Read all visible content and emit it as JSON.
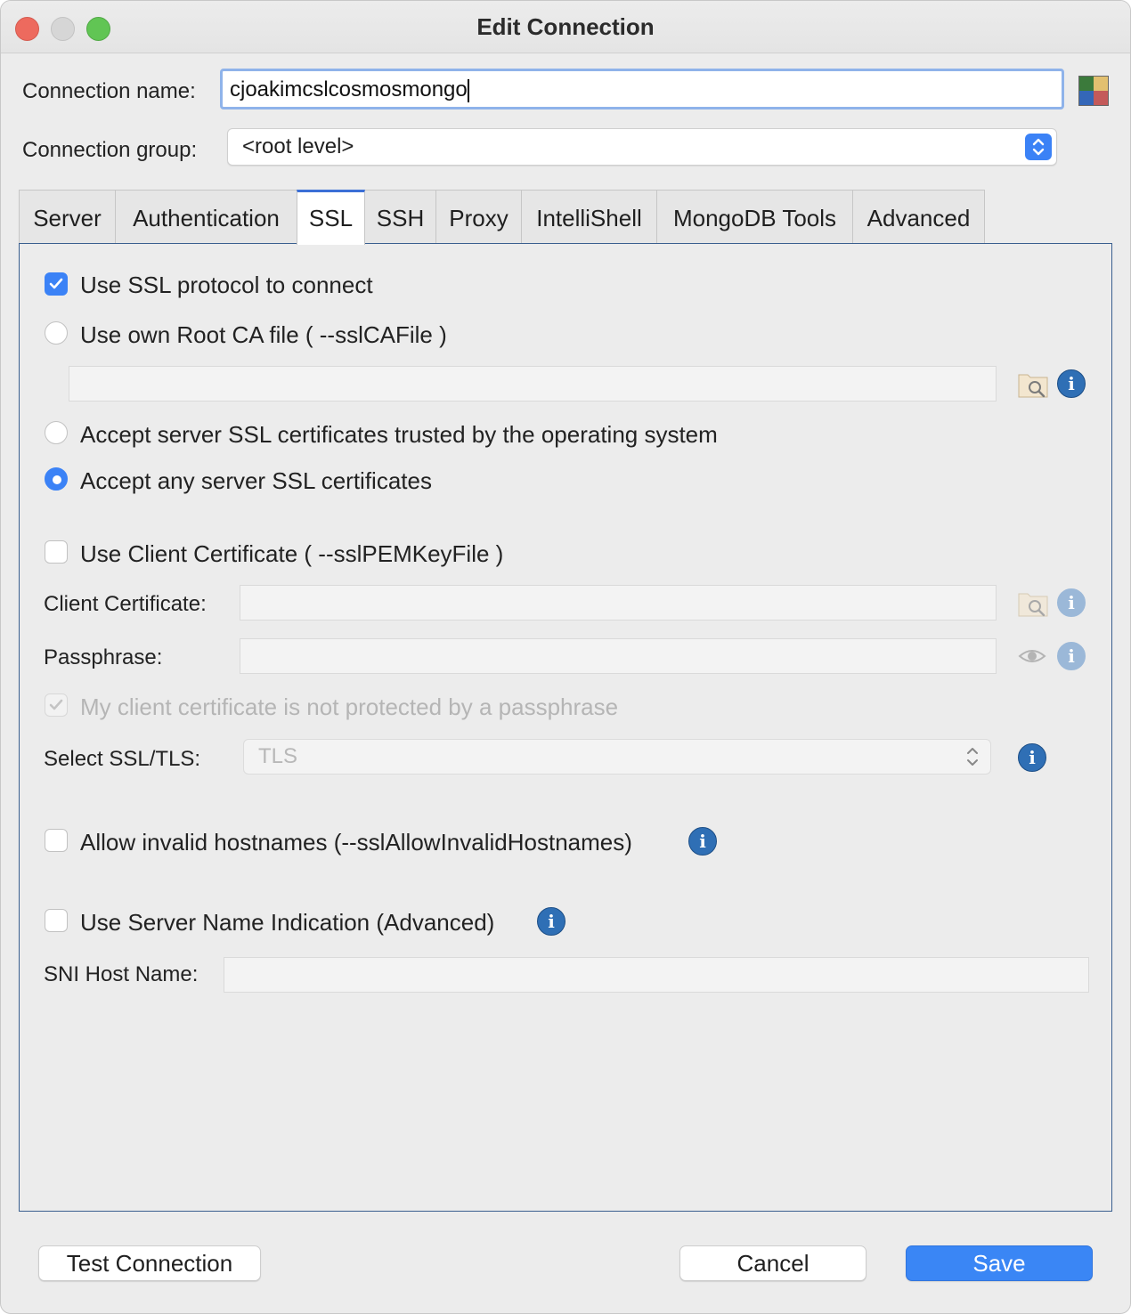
{
  "window": {
    "title": "Edit Connection"
  },
  "connection": {
    "name_label": "Connection name:",
    "name_value": "cjoakimcslcosmosmongo",
    "group_label": "Connection group:",
    "group_value": "<root level>"
  },
  "tabs": [
    "Server",
    "Authentication",
    "SSL",
    "SSH",
    "Proxy",
    "IntelliShell",
    "MongoDB Tools",
    "Advanced"
  ],
  "active_tab": "SSL",
  "ssl": {
    "use_ssl_label": "Use SSL protocol to connect",
    "use_ssl_checked": true,
    "root_ca_label": "Use own Root CA file ( --sslCAFile )",
    "trusted_os_label": "Accept server SSL certificates trusted by the operating system",
    "accept_any_label": "Accept any server SSL certificates",
    "selected_trust_option": "Accept any server SSL certificates",
    "client_cert_option_label": "Use Client Certificate ( --sslPEMKeyFile )",
    "client_cert_label": "Client Certificate:",
    "passphrase_label": "Passphrase:",
    "not_protected_label": "My client certificate is not protected by a passphrase",
    "not_protected_checked": true,
    "select_tls_label": "Select SSL/TLS:",
    "tls_value": "TLS",
    "invalid_hostnames_label": "Allow invalid hostnames (--sslAllowInvalidHostnames)",
    "sni_option_label": "Use Server Name Indication (Advanced)",
    "sni_host_label": "SNI Host Name:"
  },
  "buttons": {
    "test_connection": "Test Connection",
    "cancel": "Cancel",
    "save": "Save"
  },
  "colors": {
    "accent": "#3a86f5",
    "info_icon": "#2f6fb5",
    "panel_border": "#3a5f8f"
  }
}
